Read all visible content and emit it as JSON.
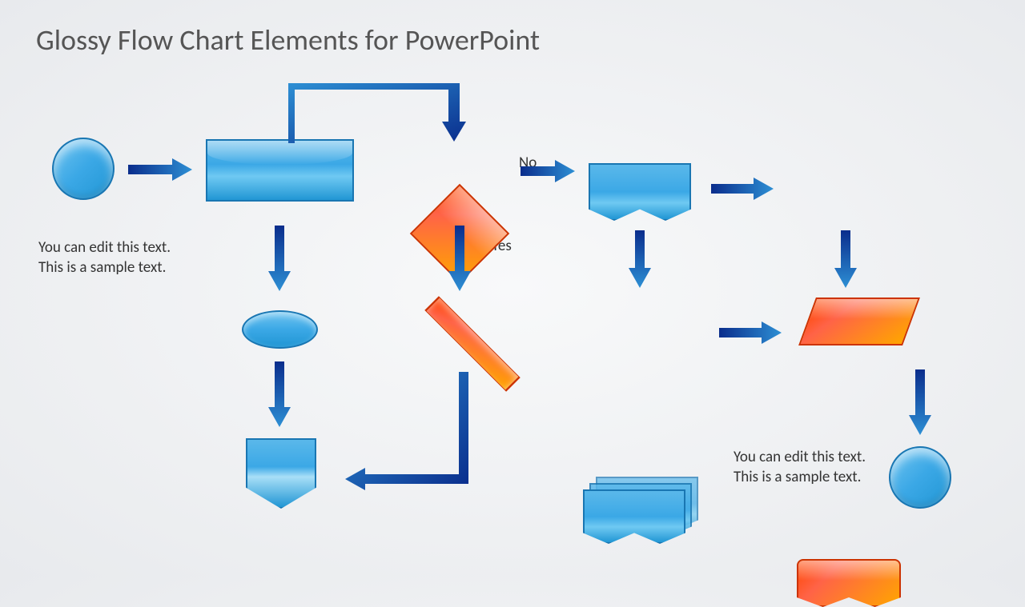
{
  "title": "Glossy Flow Chart Elements for PowerPoint",
  "sampleText1": "You can edit this text. This is a sample text.",
  "sampleText2": "You can edit this text. This is a sample text.",
  "labelNo": "No",
  "labelYes": "Yes",
  "colors": {
    "arrowDark": "#0a2d8c",
    "arrowLight": "#2d8fd4",
    "blueShape": "#3ba8e6",
    "orangeShape": "#ff6347"
  }
}
